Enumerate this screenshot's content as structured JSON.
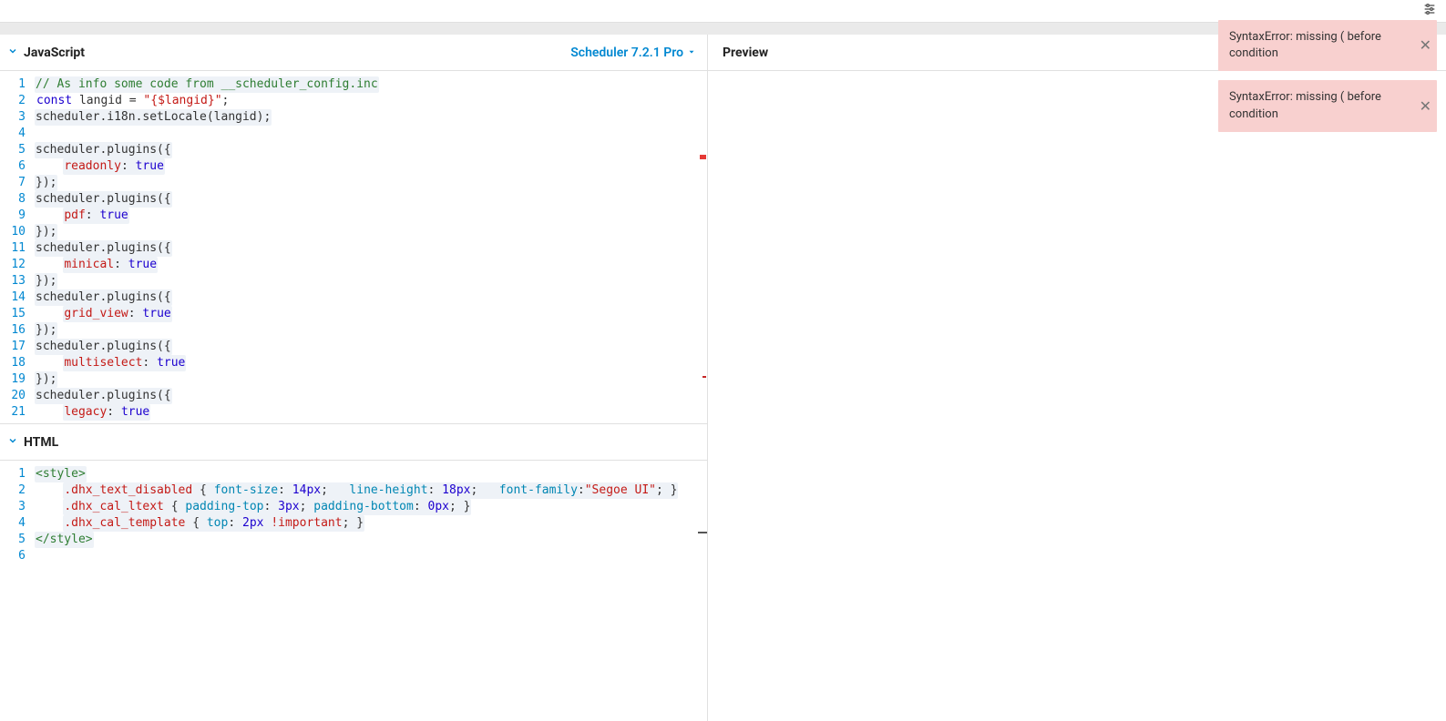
{
  "topbar": {
    "settings_icon": "settings"
  },
  "panels": {
    "js_title": "JavaScript",
    "html_title": "HTML",
    "preview_title": "Preview",
    "version_label": "Scheduler 7.2.1 Pro"
  },
  "js_editor": {
    "lines": [
      {
        "n": "1",
        "t": "comment",
        "spans": [
          {
            "c": "tok-comment tok-bg",
            "v": "// As info some code from __scheduler_config.inc"
          }
        ]
      },
      {
        "n": "2",
        "spans": [
          {
            "c": "tok-bg",
            "v": ""
          },
          {
            "c": "tok-kw",
            "v": "const"
          },
          {
            "c": "",
            "v": " langid = "
          },
          {
            "c": "tok-str",
            "v": "\"{$langid}\""
          },
          {
            "c": "",
            "v": ";"
          }
        ]
      },
      {
        "n": "3",
        "spans": [
          {
            "c": "tok-bg",
            "v": "scheduler.i18n.setLocale(langid);"
          }
        ]
      },
      {
        "n": "4",
        "spans": []
      },
      {
        "n": "5",
        "spans": [
          {
            "c": "tok-bg",
            "v": "scheduler.plugins({"
          }
        ]
      },
      {
        "n": "6",
        "indent": "    ",
        "spans": [
          {
            "c": "tok-prop",
            "v": "readonly"
          },
          {
            "c": "",
            "v": ": "
          },
          {
            "c": "tok-lit",
            "v": "true"
          }
        ]
      },
      {
        "n": "7",
        "spans": [
          {
            "c": "tok-bg",
            "v": "});"
          }
        ]
      },
      {
        "n": "8",
        "spans": [
          {
            "c": "tok-bg",
            "v": "scheduler.plugins({"
          }
        ]
      },
      {
        "n": "9",
        "indent": "    ",
        "spans": [
          {
            "c": "tok-prop",
            "v": "pdf"
          },
          {
            "c": "",
            "v": ": "
          },
          {
            "c": "tok-lit",
            "v": "true"
          }
        ]
      },
      {
        "n": "10",
        "spans": [
          {
            "c": "tok-bg",
            "v": "});"
          }
        ]
      },
      {
        "n": "11",
        "spans": [
          {
            "c": "tok-bg",
            "v": "scheduler.plugins({"
          }
        ]
      },
      {
        "n": "12",
        "indent": "    ",
        "spans": [
          {
            "c": "tok-prop",
            "v": "minical"
          },
          {
            "c": "",
            "v": ": "
          },
          {
            "c": "tok-lit",
            "v": "true"
          }
        ]
      },
      {
        "n": "13",
        "spans": [
          {
            "c": "tok-bg",
            "v": "});"
          }
        ]
      },
      {
        "n": "14",
        "spans": [
          {
            "c": "tok-bg",
            "v": "scheduler.plugins({"
          }
        ]
      },
      {
        "n": "15",
        "indent": "    ",
        "spans": [
          {
            "c": "tok-prop",
            "v": "grid_view"
          },
          {
            "c": "",
            "v": ": "
          },
          {
            "c": "tok-lit",
            "v": "true"
          }
        ]
      },
      {
        "n": "16",
        "spans": [
          {
            "c": "tok-bg",
            "v": "});"
          }
        ]
      },
      {
        "n": "17",
        "spans": [
          {
            "c": "tok-bg",
            "v": "scheduler.plugins({"
          }
        ]
      },
      {
        "n": "18",
        "indent": "    ",
        "spans": [
          {
            "c": "tok-prop",
            "v": "multiselect"
          },
          {
            "c": "",
            "v": ": "
          },
          {
            "c": "tok-lit",
            "v": "true"
          }
        ]
      },
      {
        "n": "19",
        "spans": [
          {
            "c": "tok-bg",
            "v": "});"
          }
        ]
      },
      {
        "n": "20",
        "spans": [
          {
            "c": "tok-bg",
            "v": "scheduler.plugins({"
          }
        ]
      },
      {
        "n": "21",
        "indent": "    ",
        "spans": [
          {
            "c": "tok-prop",
            "v": "legacy"
          },
          {
            "c": "",
            "v": ": "
          },
          {
            "c": "tok-lit",
            "v": "true"
          }
        ]
      }
    ]
  },
  "html_editor": {
    "lines": [
      {
        "n": "1",
        "spans": [
          {
            "c": "tok-tag tok-bg",
            "v": "<style>"
          }
        ]
      },
      {
        "n": "2",
        "indent": "    ",
        "bg": true,
        "spans": [
          {
            "c": "tok-css-sel",
            "v": ".dhx_text_disabled"
          },
          {
            "c": "",
            "v": " { "
          },
          {
            "c": "tok-css-prop",
            "v": "font-size"
          },
          {
            "c": "",
            "v": ": "
          },
          {
            "c": "tok-css-val-num",
            "v": "14px"
          },
          {
            "c": "",
            "v": ";   "
          },
          {
            "c": "tok-css-prop",
            "v": "line-height"
          },
          {
            "c": "",
            "v": ": "
          },
          {
            "c": "tok-css-val-num",
            "v": "18px"
          },
          {
            "c": "",
            "v": ";   "
          },
          {
            "c": "tok-css-prop",
            "v": "font-family"
          },
          {
            "c": "",
            "v": ":"
          },
          {
            "c": "tok-css-val-str",
            "v": "\"Segoe UI\""
          },
          {
            "c": "",
            "v": "; }"
          }
        ]
      },
      {
        "n": "3",
        "indent": "    ",
        "bg": true,
        "spans": [
          {
            "c": "tok-css-sel",
            "v": ".dhx_cal_ltext"
          },
          {
            "c": "",
            "v": " { "
          },
          {
            "c": "tok-css-prop",
            "v": "padding-top"
          },
          {
            "c": "",
            "v": ": "
          },
          {
            "c": "tok-css-val-num",
            "v": "3px"
          },
          {
            "c": "",
            "v": "; "
          },
          {
            "c": "tok-css-prop",
            "v": "padding-bottom"
          },
          {
            "c": "",
            "v": ": "
          },
          {
            "c": "tok-css-val-num",
            "v": "0px"
          },
          {
            "c": "",
            "v": "; }"
          }
        ]
      },
      {
        "n": "4",
        "indent": "    ",
        "bg": true,
        "spans": [
          {
            "c": "tok-css-sel",
            "v": ".dhx_cal_template"
          },
          {
            "c": "",
            "v": " { "
          },
          {
            "c": "tok-css-prop",
            "v": "top"
          },
          {
            "c": "",
            "v": ": "
          },
          {
            "c": "tok-css-val-num",
            "v": "2px"
          },
          {
            "c": "",
            "v": " "
          },
          {
            "c": "tok-imp",
            "v": "!important"
          },
          {
            "c": "",
            "v": "; }"
          }
        ]
      },
      {
        "n": "5",
        "spans": [
          {
            "c": "tok-tag tok-bg",
            "v": "</style>"
          }
        ]
      },
      {
        "n": "6",
        "spans": []
      }
    ]
  },
  "toasts": [
    {
      "msg": "SyntaxError: missing ( before condition"
    },
    {
      "msg": "SyntaxError: missing ( before condition"
    }
  ]
}
